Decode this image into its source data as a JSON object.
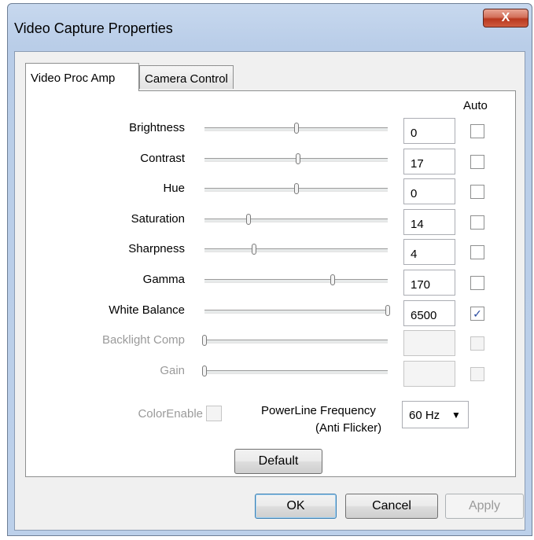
{
  "window": {
    "title": "Video Capture Properties",
    "close_glyph": "X"
  },
  "tabs": [
    {
      "label": "Video Proc Amp",
      "active": true
    },
    {
      "label": "Camera Control",
      "active": false
    }
  ],
  "auto_header": "Auto",
  "properties": [
    {
      "label": "Brightness",
      "value": "0",
      "slider": 0.5,
      "auto": false,
      "enabled": true
    },
    {
      "label": "Contrast",
      "value": "17",
      "slider": 0.51,
      "auto": false,
      "enabled": true
    },
    {
      "label": "Hue",
      "value": "0",
      "slider": 0.5,
      "auto": false,
      "enabled": true
    },
    {
      "label": "Saturation",
      "value": "14",
      "slider": 0.24,
      "auto": false,
      "enabled": true
    },
    {
      "label": "Sharpness",
      "value": "4",
      "slider": 0.27,
      "auto": false,
      "enabled": true
    },
    {
      "label": "Gamma",
      "value": "170",
      "slider": 0.7,
      "auto": false,
      "enabled": true
    },
    {
      "label": "White Balance",
      "value": "6500",
      "slider": 1.0,
      "auto": true,
      "enabled": true
    },
    {
      "label": "Backlight Comp",
      "value": "",
      "slider": 0.0,
      "auto": false,
      "enabled": false
    },
    {
      "label": "Gain",
      "value": "",
      "slider": 0.0,
      "auto": false,
      "enabled": false
    }
  ],
  "color_enable": {
    "label": "ColorEnable",
    "checked": false
  },
  "powerline": {
    "label_line1": "PowerLine Frequency",
    "label_line2": "(Anti Flicker)",
    "selected": "60 Hz",
    "arrow_glyph": "▼"
  },
  "buttons": {
    "default": "Default",
    "ok": "OK",
    "cancel": "Cancel",
    "apply": "Apply"
  },
  "checkmark_glyph": "✓",
  "icons": {
    "close": "close-icon",
    "dropdown_arrow": "chevron-down-icon",
    "checkmark": "checkmark-icon"
  }
}
